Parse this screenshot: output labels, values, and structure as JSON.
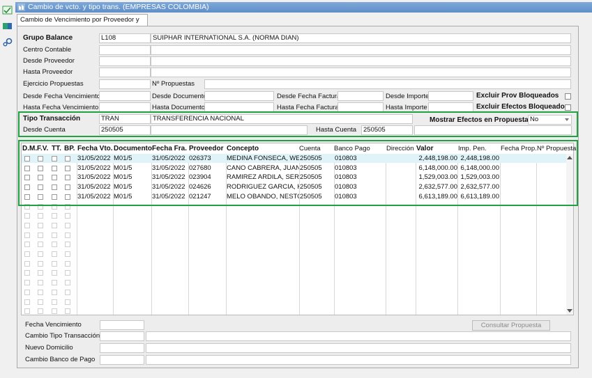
{
  "window": {
    "title": "Cambio de vcto. y tipo trans. (EMPRESAS COLOMBIA)"
  },
  "tab": {
    "label": "Cambio de Vencimiento por Proveedor y T.T."
  },
  "filters": {
    "grupo_balance_label": "Grupo Balance",
    "grupo_balance_code": "L108",
    "grupo_balance_name": "SUIPHAR INTERNATIONAL S.A. (NORMA DIAN)",
    "centro_contable_label": "Centro Contable",
    "desde_proveedor_label": "Desde Proveedor",
    "hasta_proveedor_label": "Hasta Proveedor",
    "ejercicio_propuestas_label": "Ejercicio Propuestas",
    "n_propuestas_label": "Nº Propuestas",
    "desde_fecha_venc_label": "Desde Fecha Vencimiento",
    "hasta_fecha_venc_label": "Hasta Fecha Vencimiento",
    "desde_documento_label": "Desde Documento",
    "hasta_documento_label": "Hasta Documento",
    "desde_fecha_factura_label": "Desde Fecha Factura",
    "hasta_fecha_factura_label": "Hasta Fecha Factura",
    "desde_importe_label": "Desde Importe",
    "hasta_importe_label": "Hasta Importe",
    "excluir_prov_label": "Excluir Prov Bloqueados",
    "excluir_efectos_label": "Excluir Efectos Bloqueados",
    "tipo_transaccion_label": "Tipo Transacción",
    "tipo_transaccion_code": "TRAN",
    "tipo_transaccion_name": "TRANSFERENCIA NACIONAL",
    "mostrar_efectos_label": "Mostrar Efectos en Propuestas",
    "mostrar_efectos_value": "No",
    "desde_cuenta_label": "Desde Cuenta",
    "desde_cuenta_value": "250505",
    "hasta_cuenta_label": "Hasta Cuenta",
    "hasta_cuenta_value": "250505"
  },
  "grid": {
    "headers": {
      "dm": "D.M.",
      "fv": "F.V.",
      "tt": "TT.",
      "bp": "BP.",
      "fecha_vto": "Fecha Vto.",
      "documento": "Documento",
      "fecha_fra": "Fecha Fra.",
      "proveedor": "Proveedor",
      "concepto": "Concepto",
      "cuenta": "Cuenta",
      "banco_pago": "Banco Pago",
      "direccion": "Dirección",
      "valor": "Valor",
      "imp_pen": "Imp. Pen.",
      "fecha_prop": "Fecha Prop.",
      "n_propuesta": "Nº Propuesta"
    },
    "rows": [
      {
        "fecha_vto": "31/05/2022",
        "documento": "M01/5",
        "fecha_fra": "31/05/2022",
        "proveedor": "026373",
        "concepto": "MEDINA FONSECA, WEND",
        "cuenta": "250505",
        "banco_pago": "010803",
        "valor": "2,448,198.00",
        "imp_pen": "2,448,198.00"
      },
      {
        "fecha_vto": "31/05/2022",
        "documento": "M01/5",
        "fecha_fra": "31/05/2022",
        "proveedor": "027680",
        "concepto": "CANO CABRERA, JUAN CA",
        "cuenta": "250505",
        "banco_pago": "010803",
        "valor": "6,148,000.00",
        "imp_pen": "6,148,000.00"
      },
      {
        "fecha_vto": "31/05/2022",
        "documento": "M01/5",
        "fecha_fra": "31/05/2022",
        "proveedor": "023904",
        "concepto": "RAMIREZ ARDILA, SERGIO",
        "cuenta": "250505",
        "banco_pago": "010803",
        "valor": "1,529,003.00",
        "imp_pen": "1,529,003.00"
      },
      {
        "fecha_vto": "31/05/2022",
        "documento": "M01/5",
        "fecha_fra": "31/05/2022",
        "proveedor": "024626",
        "concepto": "RODRIGUEZ GARCIA, KEV",
        "cuenta": "250505",
        "banco_pago": "010803",
        "valor": "2,632,577.00",
        "imp_pen": "2,632,577.00"
      },
      {
        "fecha_vto": "31/05/2022",
        "documento": "M01/5",
        "fecha_fra": "31/05/2022",
        "proveedor": "021247",
        "concepto": "MELO OBANDO, NESTOR I",
        "cuenta": "250505",
        "banco_pago": "010803",
        "valor": "6,613,189.00",
        "imp_pen": "6,613,189.00"
      }
    ]
  },
  "bottom": {
    "fecha_vencimiento_label": "Fecha Vencimiento",
    "cambio_tipo_label": "Cambio Tipo Transacción",
    "nuevo_domicilio_label": "Nuevo Domicilio",
    "cambio_banco_label": "Cambio Banco de Pago",
    "consultar_button": "Consultar Propuesta"
  },
  "colors": {
    "accent_green": "#20a040",
    "title_blue": "#6c97cf",
    "row_highlight": "#dff3f8"
  }
}
